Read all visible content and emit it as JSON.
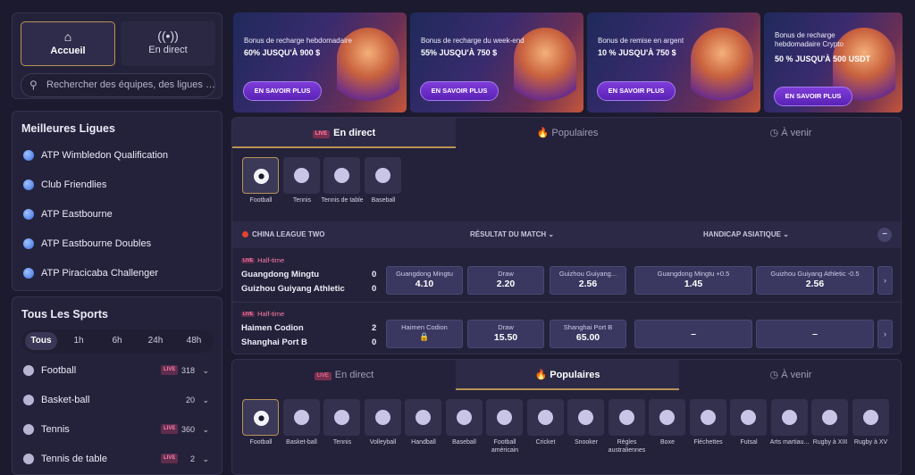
{
  "home_tabs": {
    "home_label": "Accueil",
    "live_label": "En direct"
  },
  "search": {
    "placeholder": "Rechercher des équipes, des ligues …"
  },
  "top_leagues": {
    "title": "Meilleures Ligues",
    "items": [
      "ATP Wimbledon Qualification",
      "Club Friendlies",
      "ATP Eastbourne",
      "ATP Eastbourne Doubles",
      "ATP Piracicaba Challenger"
    ]
  },
  "all_sports": {
    "title": "Tous Les Sports",
    "time_filters": [
      "Tous",
      "1h",
      "6h",
      "24h",
      "48h"
    ],
    "items": [
      {
        "name": "Football",
        "live": "LIVE",
        "count": "318"
      },
      {
        "name": "Basket-ball",
        "live": "",
        "count": "20"
      },
      {
        "name": "Tennis",
        "live": "LIVE",
        "count": "360"
      },
      {
        "name": "Tennis de table",
        "live": "LIVE",
        "count": "2"
      }
    ]
  },
  "banners": [
    {
      "title": "Bonus de recharge hebdomadaire",
      "amount": "60% JUSQU'À 900 $",
      "button": "EN SAVOIR PLUS"
    },
    {
      "title": "Bonus de recharge du week-end",
      "amount": "55% JUSQU'À 750 $",
      "button": "EN SAVOIR PLUS"
    },
    {
      "title": "Bonus de remise en argent",
      "amount": "10 % JUSQU'À 750 $",
      "button": "EN SAVOIR PLUS"
    },
    {
      "title": "Bonus de recharge hebdomadaire Crypto",
      "amount": "50 % JUSQU'À 500 USDT",
      "button": "EN SAVOIR PLUS"
    }
  ],
  "live_panel": {
    "tabs": [
      {
        "label": "En direct",
        "badge": "LIVE"
      },
      {
        "label": "Populaires"
      },
      {
        "label": "À venir"
      }
    ],
    "sports": [
      "Football",
      "Tennis",
      "Tennis de table",
      "Baseball"
    ],
    "league_header": {
      "league": "CHINA LEAGUE TWO",
      "market1": "RÉSULTAT DU MATCH",
      "market2": "HANDICAP ASIATIQUE"
    },
    "matches": [
      {
        "status": "Half-time",
        "badge": "LIVE",
        "home": "Guangdong Mingtu",
        "away": "Guizhou Guiyang Athletic",
        "home_score": "0",
        "away_score": "0",
        "odds": [
          {
            "label": "Guangdong Mingtu",
            "value": "4.10"
          },
          {
            "label": "Draw",
            "value": "2.20"
          },
          {
            "label": "Guizhou Guiyang...",
            "value": "2.56"
          },
          {
            "label": "Guangdong Mingtu +0.5",
            "value": "1.45"
          },
          {
            "label": "Guizhou Guiyang Athletic -0.5",
            "value": "2.56"
          }
        ]
      },
      {
        "status": "Half-time",
        "badge": "LIVE",
        "home": "Haimen Codion",
        "away": "Shanghai Port B",
        "home_score": "2",
        "away_score": "0",
        "odds": [
          {
            "label": "Haimen Codion",
            "value": "🔒"
          },
          {
            "label": "Draw",
            "value": "15.50"
          },
          {
            "label": "Shanghai Port B",
            "value": "65.00"
          },
          {
            "label": "",
            "value": "–"
          },
          {
            "label": "",
            "value": "–"
          }
        ]
      }
    ]
  },
  "popular_panel": {
    "tabs": [
      {
        "label": "En direct",
        "badge": "LIVE"
      },
      {
        "label": "Populaires"
      },
      {
        "label": "À venir"
      }
    ],
    "sports": [
      "Football",
      "Basket-ball",
      "Tennis",
      "Volleyball",
      "Handball",
      "Baseball",
      "Football américain",
      "Cricket",
      "Snooker",
      "Règles australiennes",
      "Boxe",
      "Fléchettes",
      "Futsal",
      "Arts martiau...",
      "Rugby à XIII",
      "Rugby à XV"
    ]
  }
}
